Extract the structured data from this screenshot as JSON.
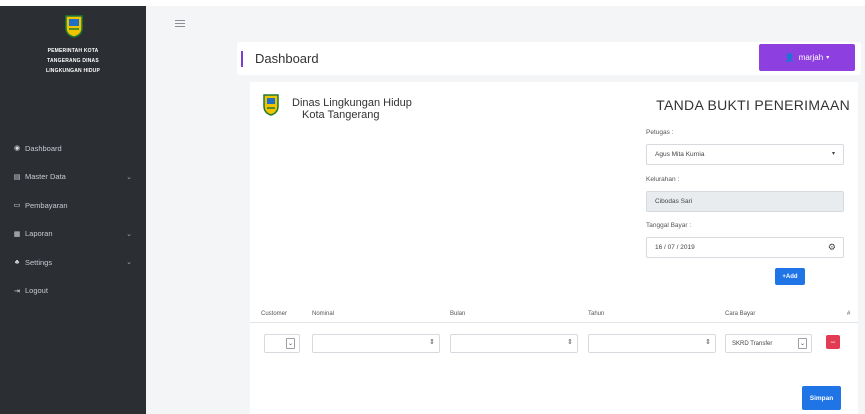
{
  "sidebar": {
    "brand_lines": [
      "PEMERINTAH KOTA",
      "TANGERANG DINAS",
      "LINGKUNGAN HIDUP"
    ],
    "items": [
      {
        "label": "Dashboard",
        "icon": "dashboard-icon",
        "has_chevron": false
      },
      {
        "label": "Master Data",
        "icon": "database-icon",
        "has_chevron": true
      },
      {
        "label": "Pembayaran",
        "icon": "credit-card-icon",
        "has_chevron": false
      },
      {
        "label": "Laporan",
        "icon": "report-icon",
        "has_chevron": true
      },
      {
        "label": "Settings",
        "icon": "users-cog-icon",
        "has_chevron": true
      },
      {
        "label": "Logout",
        "icon": "logout-icon",
        "has_chevron": false
      }
    ]
  },
  "header": {
    "title": "Dashboard",
    "user_name": "marjah"
  },
  "card": {
    "org_line1": "Dinas Lingkungan Hidup",
    "org_line2": "Kota Tangerang",
    "receipt_title": "TANDA BUKTI PENERIMAAN",
    "petugas_label": "Petugas :",
    "petugas_value": "Agus Mita Kurnia",
    "kelurahan_label": "Kelurahan :",
    "kelurahan_value": "Cibodas Sari",
    "tanggal_label": "Tanggal Bayar :",
    "tanggal_value": "16 / 07 / 2019",
    "add_label": "+Add",
    "table": {
      "headers": [
        "Customer",
        "Nominal",
        "Bulan",
        "Tahun",
        "Cara Bayar",
        "#"
      ],
      "cara_bayar_value": "SKRD Transfer"
    },
    "save_label": "Simpan"
  },
  "colors": {
    "sidebar_bg": "#2b2e33",
    "accent_purple": "#8e3fe0",
    "primary_blue": "#1f74e6",
    "danger_red": "#e23b52"
  }
}
